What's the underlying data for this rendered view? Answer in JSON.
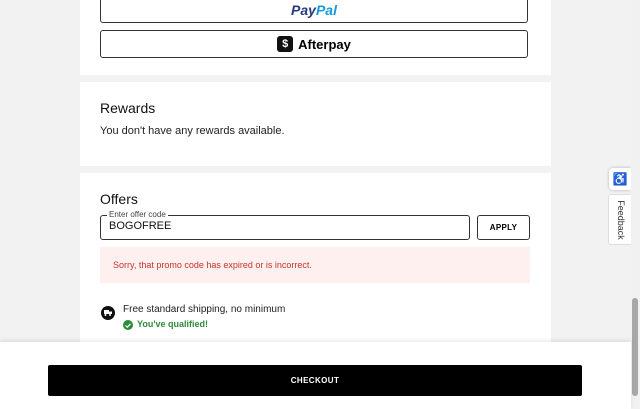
{
  "payment": {
    "paypal_part1": "Pay",
    "paypal_part2": "Pal",
    "afterpay_logo": "$",
    "afterpay_label": "Afterpay"
  },
  "rewards": {
    "heading": "Rewards",
    "message": "You don't have any rewards available."
  },
  "offers": {
    "heading": "Offers",
    "field_label": "Enter offer code",
    "field_value": "BOGOFREE",
    "apply_label": "APPLY",
    "error_message": "Sorry, that promo code has expired or is incorrect.",
    "shipping_text": "Free standard shipping, no minimum",
    "qualified_text": "You've qualified!"
  },
  "side": {
    "feedback_label": "Feedback"
  },
  "checkout": {
    "label": "CHECKOUT"
  },
  "colors": {
    "error": "#c8322c",
    "success": "#2e8b3a",
    "paypal_dark": "#253b80",
    "paypal_light": "#179bd7"
  },
  "icons": [
    "paypal-logo-icon",
    "afterpay-logo-icon",
    "truck-icon",
    "check-icon",
    "accessibility-icon"
  ]
}
